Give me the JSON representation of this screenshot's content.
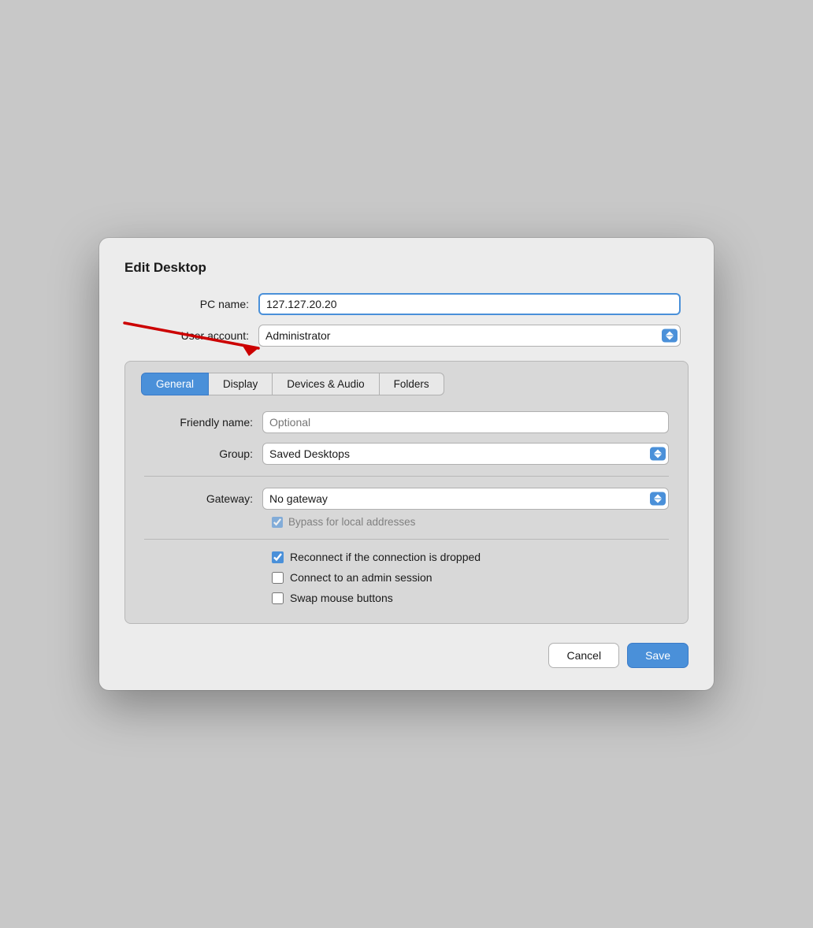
{
  "dialog": {
    "title": "Edit Desktop"
  },
  "fields": {
    "pc_name_label": "PC name:",
    "pc_name_value": "127.127.20.20",
    "user_account_label": "User account:",
    "user_account_value": "Administrator"
  },
  "tabs": {
    "items": [
      {
        "label": "General",
        "active": true
      },
      {
        "label": "Display",
        "active": false
      },
      {
        "label": "Devices & Audio",
        "active": false
      },
      {
        "label": "Folders",
        "active": false
      }
    ]
  },
  "general_tab": {
    "friendly_name_label": "Friendly name:",
    "friendly_name_placeholder": "Optional",
    "group_label": "Group:",
    "group_value": "Saved Desktops",
    "gateway_label": "Gateway:",
    "gateway_value": "No gateway",
    "bypass_label": "Bypass for local addresses",
    "checkboxes": [
      {
        "label": "Reconnect if the connection is dropped",
        "checked": true
      },
      {
        "label": "Connect to an admin session",
        "checked": false
      },
      {
        "label": "Swap mouse buttons",
        "checked": false
      }
    ]
  },
  "footer": {
    "cancel_label": "Cancel",
    "save_label": "Save"
  }
}
